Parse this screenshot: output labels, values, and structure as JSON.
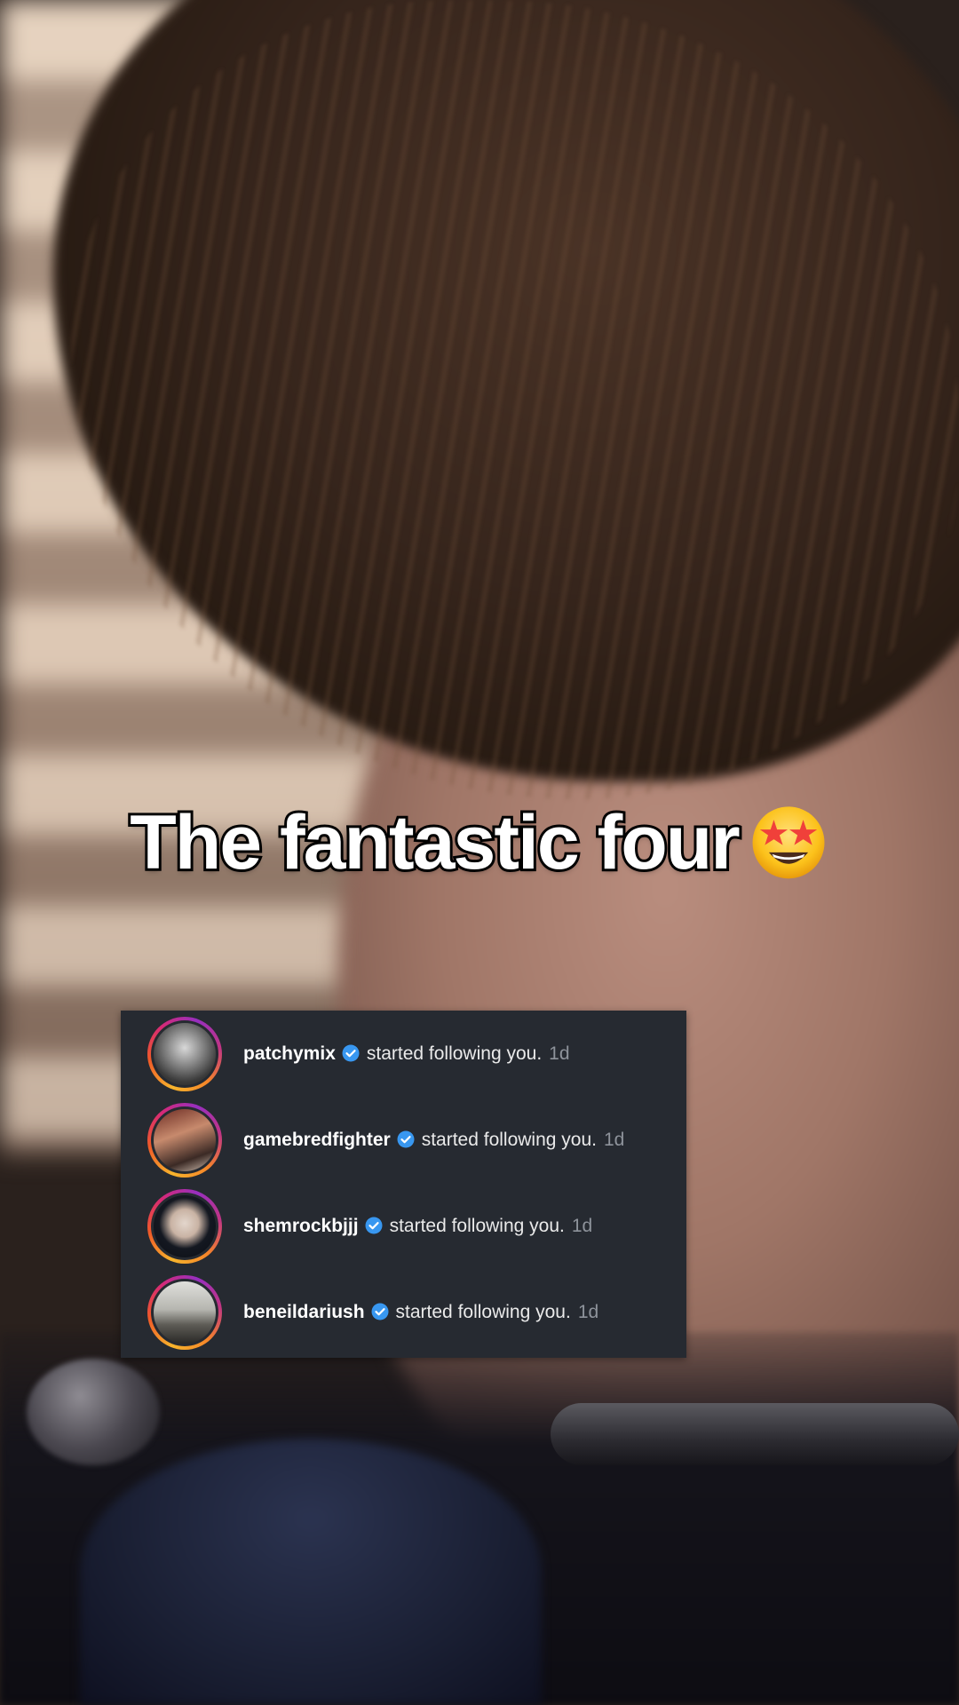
{
  "caption": {
    "text": "The fantastic four",
    "emoji": "star-struck-emoji"
  },
  "notifications": [
    {
      "username": "patchymix",
      "action": "started following you.",
      "time": "1d",
      "verified": true
    },
    {
      "username": "gamebredfighter",
      "action": "started following you.",
      "time": "1d",
      "verified": true
    },
    {
      "username": "shemrockbjjj",
      "action": "started following you.",
      "time": "1d",
      "verified": true
    },
    {
      "username": "beneildariush",
      "action": "started following you.",
      "time": "1d",
      "verified": true
    }
  ],
  "colors": {
    "card_bg": "#262a31",
    "verified_blue": "#3897f0",
    "timestamp": "#8e939b"
  }
}
